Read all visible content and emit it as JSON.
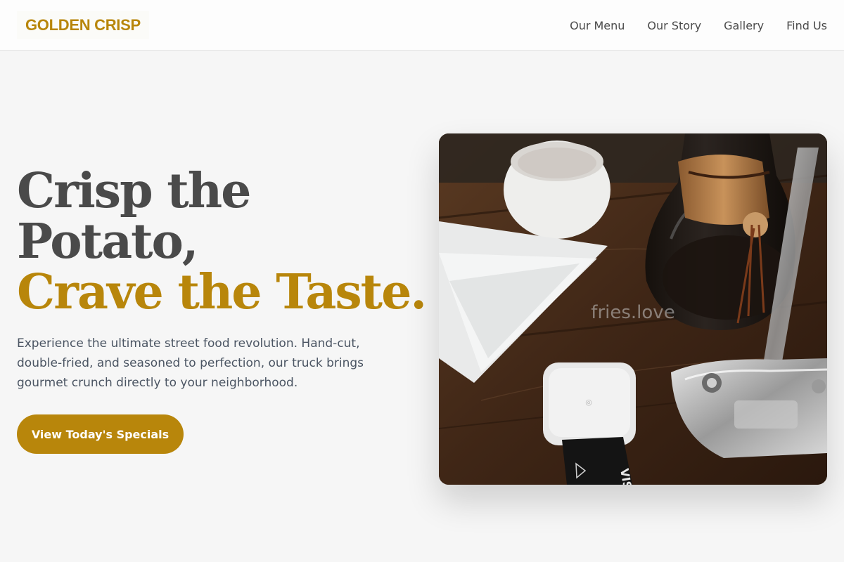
{
  "brand": {
    "name": "GOLDEN CRISP",
    "accent_color": "#b8860b"
  },
  "nav": {
    "items": [
      {
        "label": "Our Menu"
      },
      {
        "label": "Our Story"
      },
      {
        "label": "Gallery"
      },
      {
        "label": "Find Us"
      }
    ]
  },
  "hero": {
    "title_line1": "Crisp the",
    "title_line2": "Potato,",
    "title_line3": "Crave the Taste.",
    "description": "Experience the ultimate street food revolution. Hand-cut, double-fried, and seasoned to perfection, our truck brings gourmet crunch directly to your neighborhood.",
    "cta_label": "View Today's Specials",
    "image_alt": "fries.love"
  }
}
